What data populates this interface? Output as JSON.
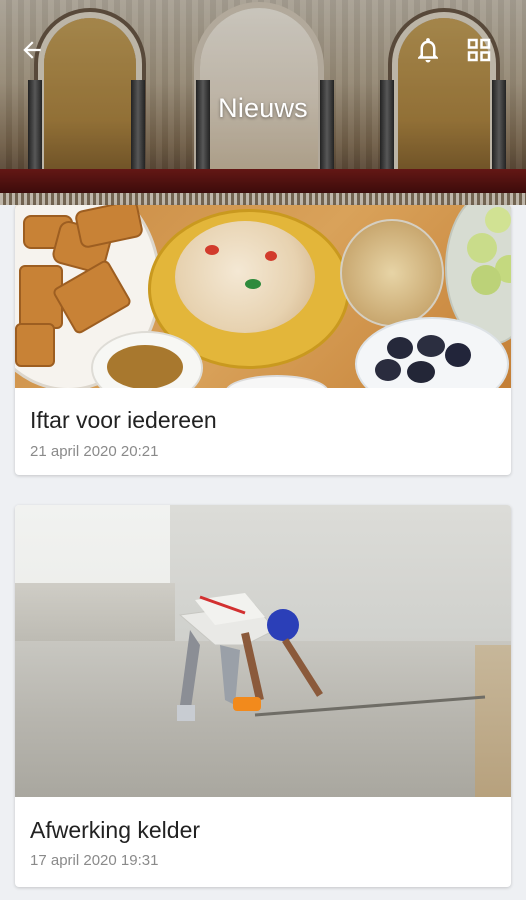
{
  "header": {
    "title": "Nieuws",
    "back_icon": "arrow-left-icon",
    "notification_icon": "bell-icon",
    "apps_icon": "grid-icon"
  },
  "news": [
    {
      "title": "Iftar voor iedereen",
      "date": "21 april 2020 20:21"
    },
    {
      "title": "Afwerking kelder",
      "date": "17 april 2020 19:31"
    }
  ],
  "colors": {
    "background": "#eef0f3",
    "card": "#ffffff",
    "title_text": "#222222",
    "date_text": "#8a8a8a",
    "header_text": "#ffffff"
  }
}
